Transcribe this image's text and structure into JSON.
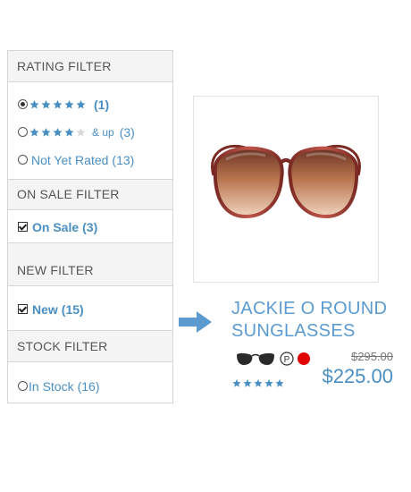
{
  "filters": {
    "rating": {
      "title": "RATING FILTER",
      "options": [
        {
          "count": "(1)",
          "stars": 5,
          "checked": true
        },
        {
          "count": "(3)",
          "stars": 4,
          "and_up": "& up",
          "checked": false
        },
        {
          "label": "Not Yet Rated",
          "count": "(13)",
          "checked": false
        }
      ]
    },
    "sale": {
      "title": "ON SALE FILTER",
      "option": {
        "label": "On Sale",
        "count": "(3)",
        "checked": true
      }
    },
    "new": {
      "title": "NEW FILTER",
      "option": {
        "label": "New",
        "count": "(15)",
        "checked": true
      }
    },
    "stock": {
      "title": "STOCK FILTER",
      "option": {
        "label": "In Stock",
        "count": "(16)",
        "checked": false
      }
    }
  },
  "product": {
    "title_line1": "JACKIE O ROUND",
    "title_line2": "SUNGLASSES",
    "old_price": "$295.00",
    "price": "$225.00",
    "rating_stars": 5,
    "icons": [
      "sunglasses-icon",
      "polarized-p-icon",
      "red-dot-icon"
    ]
  },
  "colors": {
    "accent": "#4a8fc3",
    "title": "#5b9bcf",
    "arrow": "#5b9bcf",
    "red": "#e00000"
  }
}
